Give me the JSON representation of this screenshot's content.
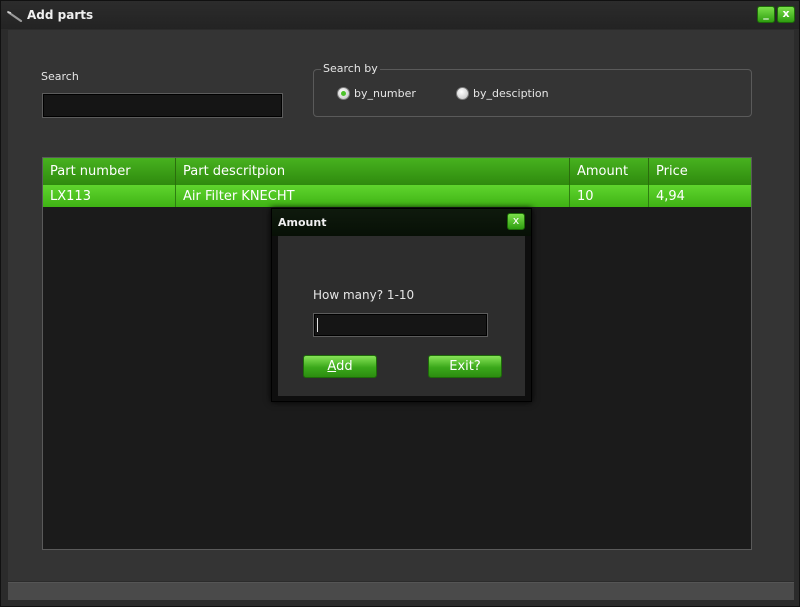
{
  "window": {
    "title": "Add parts",
    "minimize_label": "_",
    "close_label": "x"
  },
  "search": {
    "label": "Search",
    "value": ""
  },
  "search_by": {
    "title": "Search by",
    "options": [
      {
        "label": "by_number",
        "checked": true
      },
      {
        "label": "by_desciption",
        "checked": false
      }
    ]
  },
  "table": {
    "columns": [
      "Part number",
      "Part descritpion",
      "Amount",
      "Price"
    ],
    "rows": [
      [
        "LX113",
        "Air Filter KNECHT",
        "10",
        "4,94"
      ]
    ]
  },
  "dialog": {
    "title": "Amount",
    "close_label": "x",
    "prompt": "How many? 1-10",
    "input_value": "",
    "add_label_accel": "A",
    "add_label_rest": "dd",
    "exit_label": "Exit?"
  },
  "colors": {
    "accent": "#3fb214",
    "background": "#343434"
  }
}
